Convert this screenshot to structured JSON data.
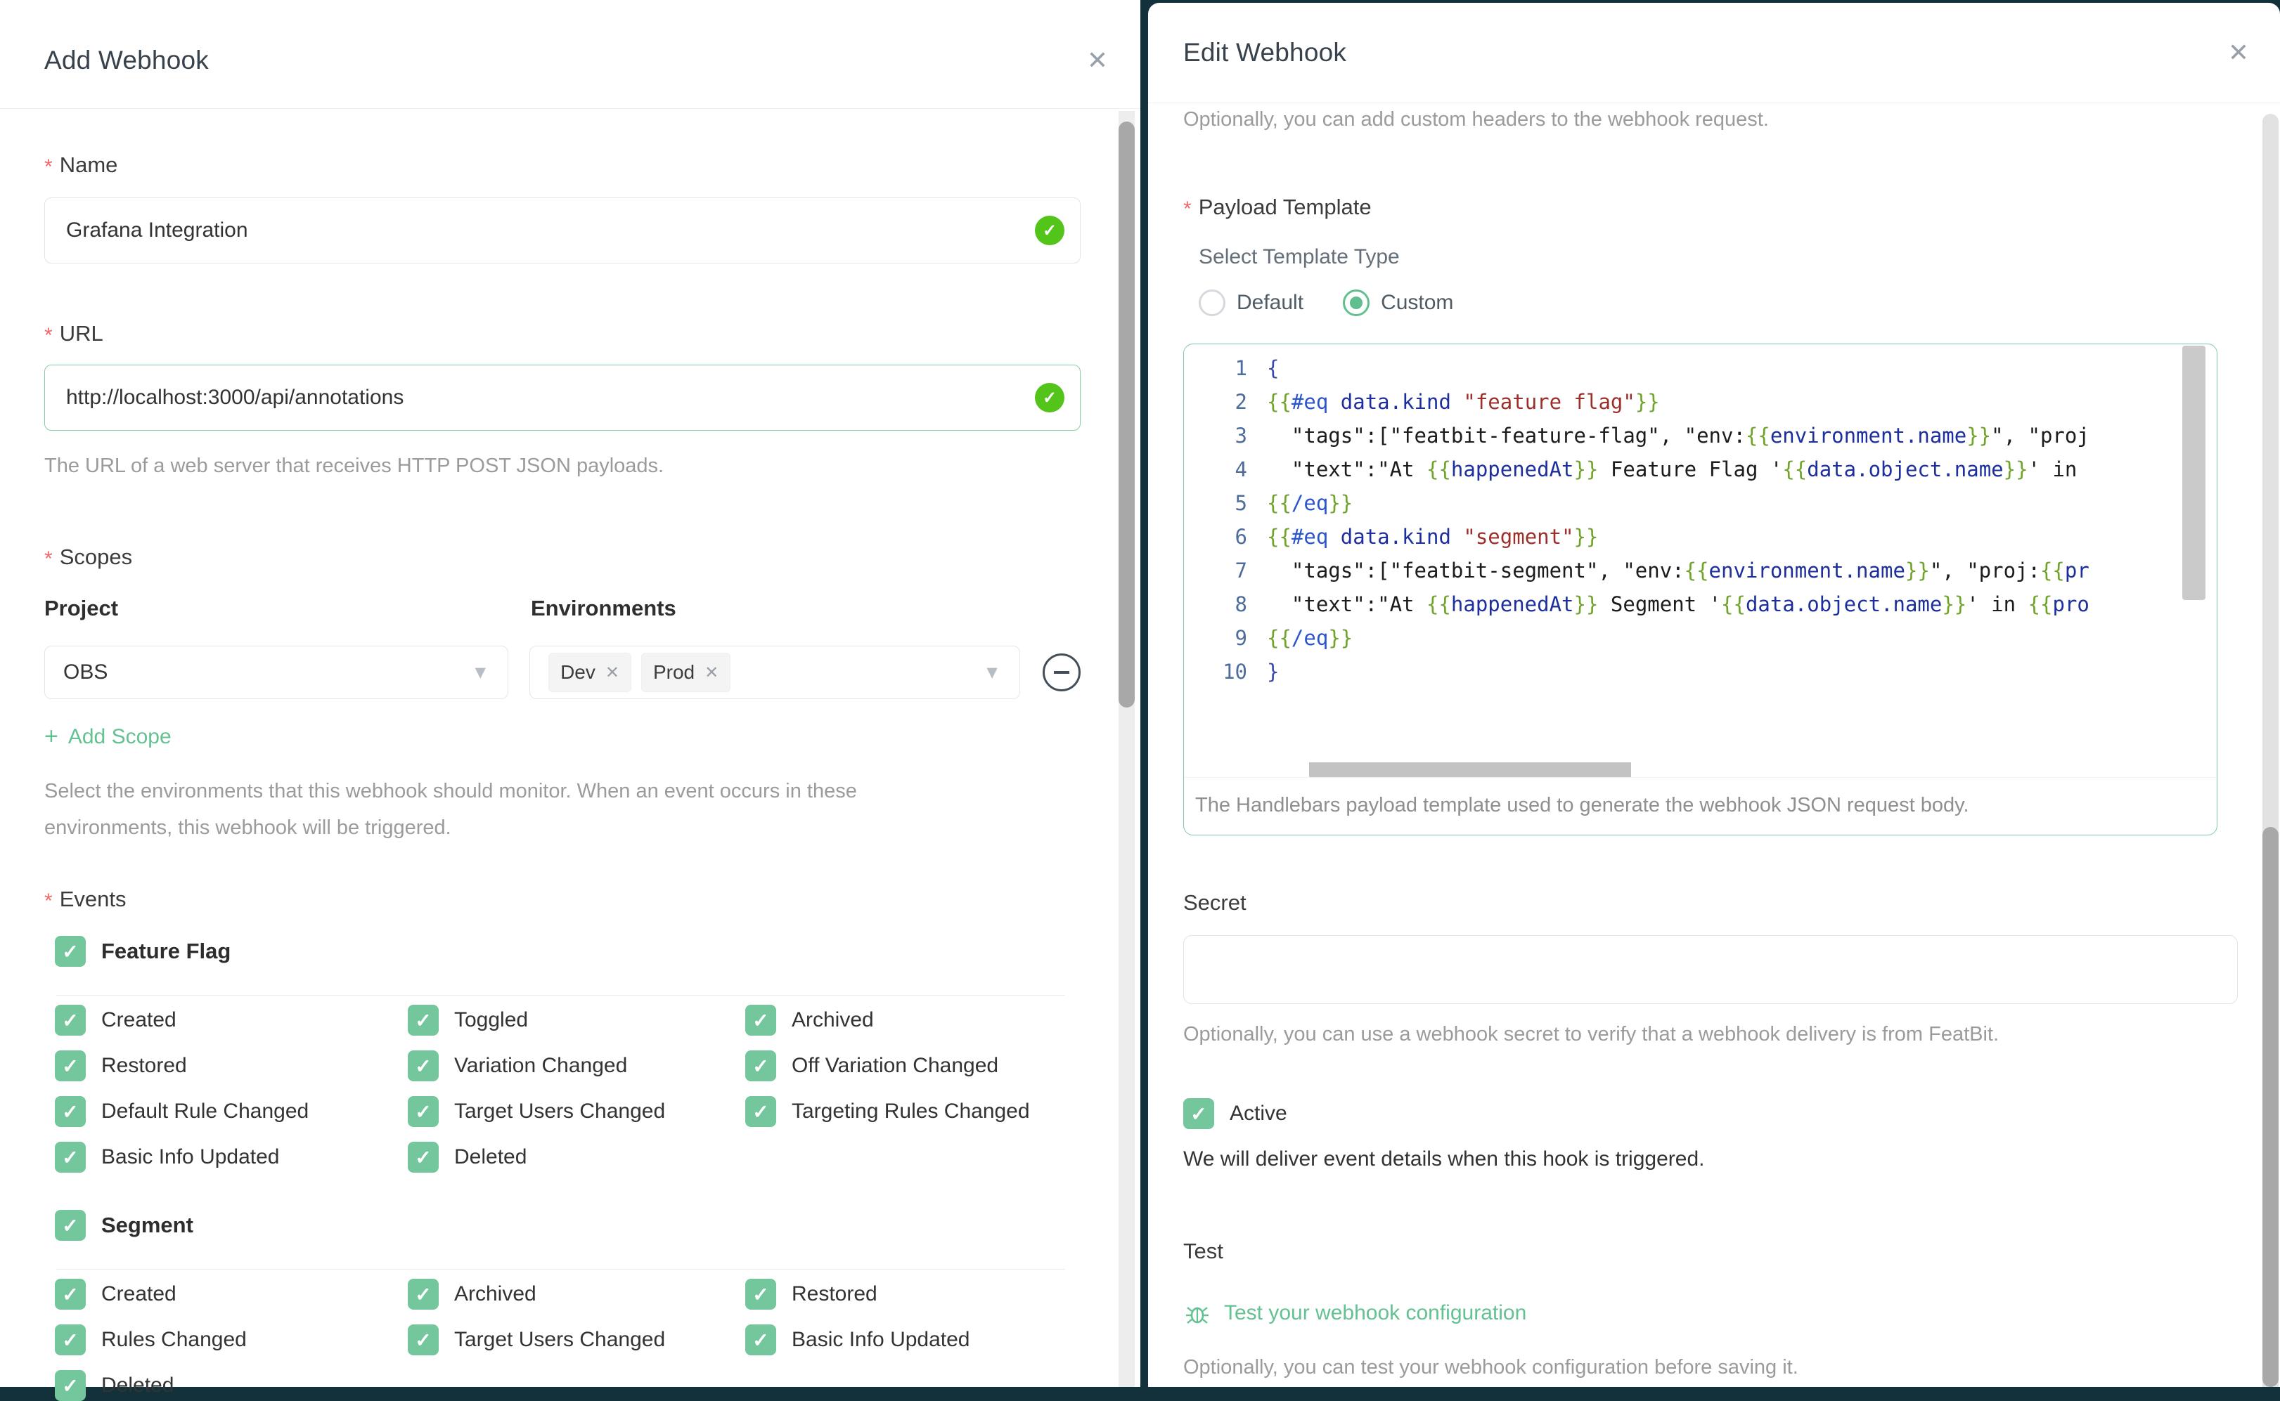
{
  "icons": {
    "close": "✕",
    "caret_down": "▼",
    "check": "✓",
    "plus": "+",
    "tag_close": "✕",
    "required_marker": "*"
  },
  "colors": {
    "accent_green": "#64c191",
    "checkbox_green": "#74c69c",
    "valid_badge_green": "#52c41a",
    "editor_border_green": "#82c9a3",
    "required_red": "#f06a6a",
    "backdrop": "#12313a"
  },
  "left_modal": {
    "title": "Add Webhook",
    "name": {
      "label": "Name",
      "value": "Grafana Integration"
    },
    "url": {
      "label": "URL",
      "value": "http://localhost:3000/api/annotations",
      "help": "The URL of a web server that receives HTTP POST JSON payloads."
    },
    "scopes": {
      "label": "Scopes",
      "project_label": "Project",
      "environments_label": "Environments",
      "project_value": "OBS",
      "environment_tags": [
        "Dev",
        "Prod"
      ],
      "add_scope_label": "Add Scope",
      "help": "Select the environments that this webhook should monitor. When an event occurs in these environments, this webhook will be triggered."
    },
    "events": {
      "label": "Events",
      "groups": [
        {
          "name": "Feature Flag",
          "checked": true,
          "items": [
            "Created",
            "Toggled",
            "Archived",
            "Restored",
            "Variation Changed",
            "Off Variation Changed",
            "Default Rule Changed",
            "Target Users Changed",
            "Targeting Rules Changed",
            "Basic Info Updated",
            "Deleted"
          ]
        },
        {
          "name": "Segment",
          "checked": true,
          "items": [
            "Created",
            "Archived",
            "Restored",
            "Rules Changed",
            "Target Users Changed",
            "Basic Info Updated",
            "Deleted"
          ]
        }
      ]
    }
  },
  "right_modal": {
    "title": "Edit Webhook",
    "headers_help": "Optionally, you can add custom headers to the webhook request.",
    "payload_template": {
      "label": "Payload Template",
      "select_type_label": "Select Template Type",
      "options": [
        {
          "label": "Default",
          "selected": false
        },
        {
          "label": "Custom",
          "selected": true
        }
      ],
      "help": "The Handlebars payload template used to generate the webhook JSON request body.",
      "code_lines": [
        {
          "n": "1",
          "tokens": [
            {
              "s": "br",
              "t": "{"
            }
          ]
        },
        {
          "n": "2",
          "tokens": [
            {
              "s": "mu",
              "t": "{{"
            },
            {
              "s": "kw",
              "t": "#eq"
            },
            {
              "s": "pl",
              "t": " "
            },
            {
              "s": "pa",
              "t": "data.kind"
            },
            {
              "s": "pl",
              "t": " "
            },
            {
              "s": "st",
              "t": "\"feature flag\""
            },
            {
              "s": "mu",
              "t": "}}"
            }
          ]
        },
        {
          "n": "3",
          "tokens": [
            {
              "s": "pl",
              "t": "  \"tags\":[\"featbit-feature-flag\", \"env:"
            },
            {
              "s": "mu",
              "t": "{{"
            },
            {
              "s": "pa",
              "t": "environment.name"
            },
            {
              "s": "mu",
              "t": "}}"
            },
            {
              "s": "pl",
              "t": "\", \"proj"
            }
          ]
        },
        {
          "n": "4",
          "tokens": [
            {
              "s": "pl",
              "t": "  \"text\":\"At "
            },
            {
              "s": "mu",
              "t": "{{"
            },
            {
              "s": "pa",
              "t": "happenedAt"
            },
            {
              "s": "mu",
              "t": "}}"
            },
            {
              "s": "pl",
              "t": " Feature Flag '"
            },
            {
              "s": "mu",
              "t": "{{"
            },
            {
              "s": "pa",
              "t": "data.object.name"
            },
            {
              "s": "mu",
              "t": "}}"
            },
            {
              "s": "pl",
              "t": "' in"
            }
          ]
        },
        {
          "n": "5",
          "tokens": [
            {
              "s": "mu",
              "t": "{{"
            },
            {
              "s": "kw",
              "t": "/eq"
            },
            {
              "s": "mu",
              "t": "}}"
            }
          ]
        },
        {
          "n": "6",
          "tokens": [
            {
              "s": "mu",
              "t": "{{"
            },
            {
              "s": "kw",
              "t": "#eq"
            },
            {
              "s": "pl",
              "t": " "
            },
            {
              "s": "pa",
              "t": "data.kind"
            },
            {
              "s": "pl",
              "t": " "
            },
            {
              "s": "st",
              "t": "\"segment\""
            },
            {
              "s": "mu",
              "t": "}}"
            }
          ]
        },
        {
          "n": "7",
          "tokens": [
            {
              "s": "pl",
              "t": "  \"tags\":[\"featbit-segment\", \"env:"
            },
            {
              "s": "mu",
              "t": "{{"
            },
            {
              "s": "pa",
              "t": "environment.name"
            },
            {
              "s": "mu",
              "t": "}}"
            },
            {
              "s": "pl",
              "t": "\", \"proj:"
            },
            {
              "s": "mu",
              "t": "{{"
            },
            {
              "s": "pa",
              "t": "pr"
            }
          ]
        },
        {
          "n": "8",
          "tokens": [
            {
              "s": "pl",
              "t": "  \"text\":\"At "
            },
            {
              "s": "mu",
              "t": "{{"
            },
            {
              "s": "pa",
              "t": "happenedAt"
            },
            {
              "s": "mu",
              "t": "}}"
            },
            {
              "s": "pl",
              "t": " Segment '"
            },
            {
              "s": "mu",
              "t": "{{"
            },
            {
              "s": "pa",
              "t": "data.object.name"
            },
            {
              "s": "mu",
              "t": "}}"
            },
            {
              "s": "pl",
              "t": "' in "
            },
            {
              "s": "mu",
              "t": "{{"
            },
            {
              "s": "pa",
              "t": "pro"
            }
          ]
        },
        {
          "n": "9",
          "tokens": [
            {
              "s": "mu",
              "t": "{{"
            },
            {
              "s": "kw",
              "t": "/eq"
            },
            {
              "s": "mu",
              "t": "}}"
            }
          ]
        },
        {
          "n": "10",
          "tokens": [
            {
              "s": "br",
              "t": "}"
            }
          ]
        }
      ]
    },
    "secret": {
      "label": "Secret",
      "value": "",
      "help": "Optionally, you can use a webhook secret to verify that a webhook delivery is from FeatBit."
    },
    "active": {
      "label": "Active",
      "checked": true,
      "note": "We will deliver event details when this hook is triggered."
    },
    "test": {
      "label": "Test",
      "link": "Test your webhook configuration",
      "help": "Optionally, you can test your webhook configuration before saving it."
    }
  }
}
